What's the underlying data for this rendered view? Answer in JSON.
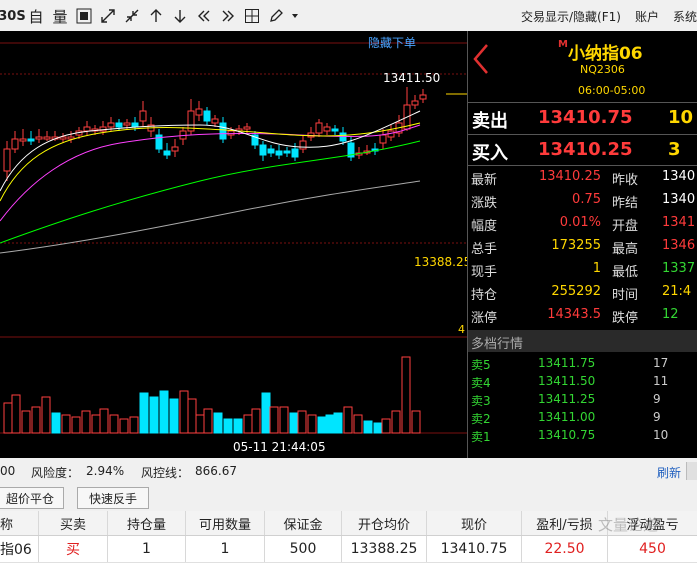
{
  "toolbar": {
    "icons": [
      "3DS",
      "自",
      "量",
      "indicator-icon",
      "expand-icon",
      "collapse-icon",
      "up-arrow-icon",
      "down-arrow-icon",
      "double-left-icon",
      "double-right-icon",
      "layout-icon",
      "draw-icon",
      "dropdown-icon"
    ],
    "labels": {
      "i0": "30S",
      "i1": "自",
      "i2": "量"
    },
    "menu": [
      "交易显示/隐藏(F1)",
      "账户",
      "系统"
    ]
  },
  "chart": {
    "hide_order_link": "隐藏下单",
    "high_label": "13411.50",
    "low_label": "13388.25",
    "vol_scale": "4",
    "time_label": "05-11 21:44:05",
    "colors": {
      "up": "#ff4040",
      "down": "#00e5ff",
      "ma5": "#ffffff",
      "ma10": "#ffff00",
      "ma20": "#ff40ff",
      "ma40": "#00ff00",
      "ma60": "#aaaaaa"
    }
  },
  "quote": {
    "prefix": "M",
    "name": "小纳指06",
    "code": "NQ2306",
    "hours": "06:00-05:00",
    "ask": {
      "label": "卖出",
      "price": "13410.75",
      "qty": "10"
    },
    "bid": {
      "label": "买入",
      "price": "13410.25",
      "qty": "3"
    },
    "rows": [
      {
        "l1": "最新",
        "v1": "13410.25",
        "l2": "昨收",
        "v2": "1340"
      },
      {
        "l1": "涨跌",
        "v1": "0.75",
        "l2": "昨结",
        "v2": "1340"
      },
      {
        "l1": "幅度",
        "v1": "0.01%",
        "l2": "开盘",
        "v2": "1341"
      },
      {
        "l1": "总手",
        "v1": "173255",
        "l2": "最高",
        "v2": "1346"
      },
      {
        "l1": "现手",
        "v1": "1",
        "l2": "最低",
        "v2": "1337"
      },
      {
        "l1": "持仓",
        "v1": "255292",
        "l2": "时间",
        "v2": "21:4"
      },
      {
        "l1": "涨停",
        "v1": "14343.5",
        "l2": "跌停",
        "v2": "12"
      }
    ],
    "depth_title": "多档行情",
    "depth": [
      {
        "label": "卖5",
        "price": "13411.75",
        "qty": "17"
      },
      {
        "label": "卖4",
        "price": "13411.50",
        "qty": "11"
      },
      {
        "label": "卖3",
        "price": "13411.25",
        "qty": "9"
      },
      {
        "label": "卖2",
        "price": "13411.00",
        "qty": "9"
      },
      {
        "label": "卖1",
        "price": "13410.75",
        "qty": "10"
      }
    ]
  },
  "status": {
    "left_value": "00",
    "risk_label": "风险度：",
    "risk_value": "2.94%",
    "line_label": "风控线：",
    "line_value": "866.67",
    "refresh": "刷新"
  },
  "actions": {
    "btn1": "超价平仓",
    "btn2": "快速反手"
  },
  "positions": {
    "headers": [
      "称",
      "买卖",
      "持仓量",
      "可用数量",
      "保证金",
      "开仓均价",
      "现价",
      "盈利/亏损",
      "浮动盈亏"
    ],
    "rows": [
      {
        "name": "指06",
        "side": "买",
        "qty": "1",
        "avail": "1",
        "margin": "500",
        "open": "13388.25",
        "price": "13410.75",
        "pl": "22.50",
        "float": "450"
      }
    ]
  },
  "watermark": "文量论道"
}
